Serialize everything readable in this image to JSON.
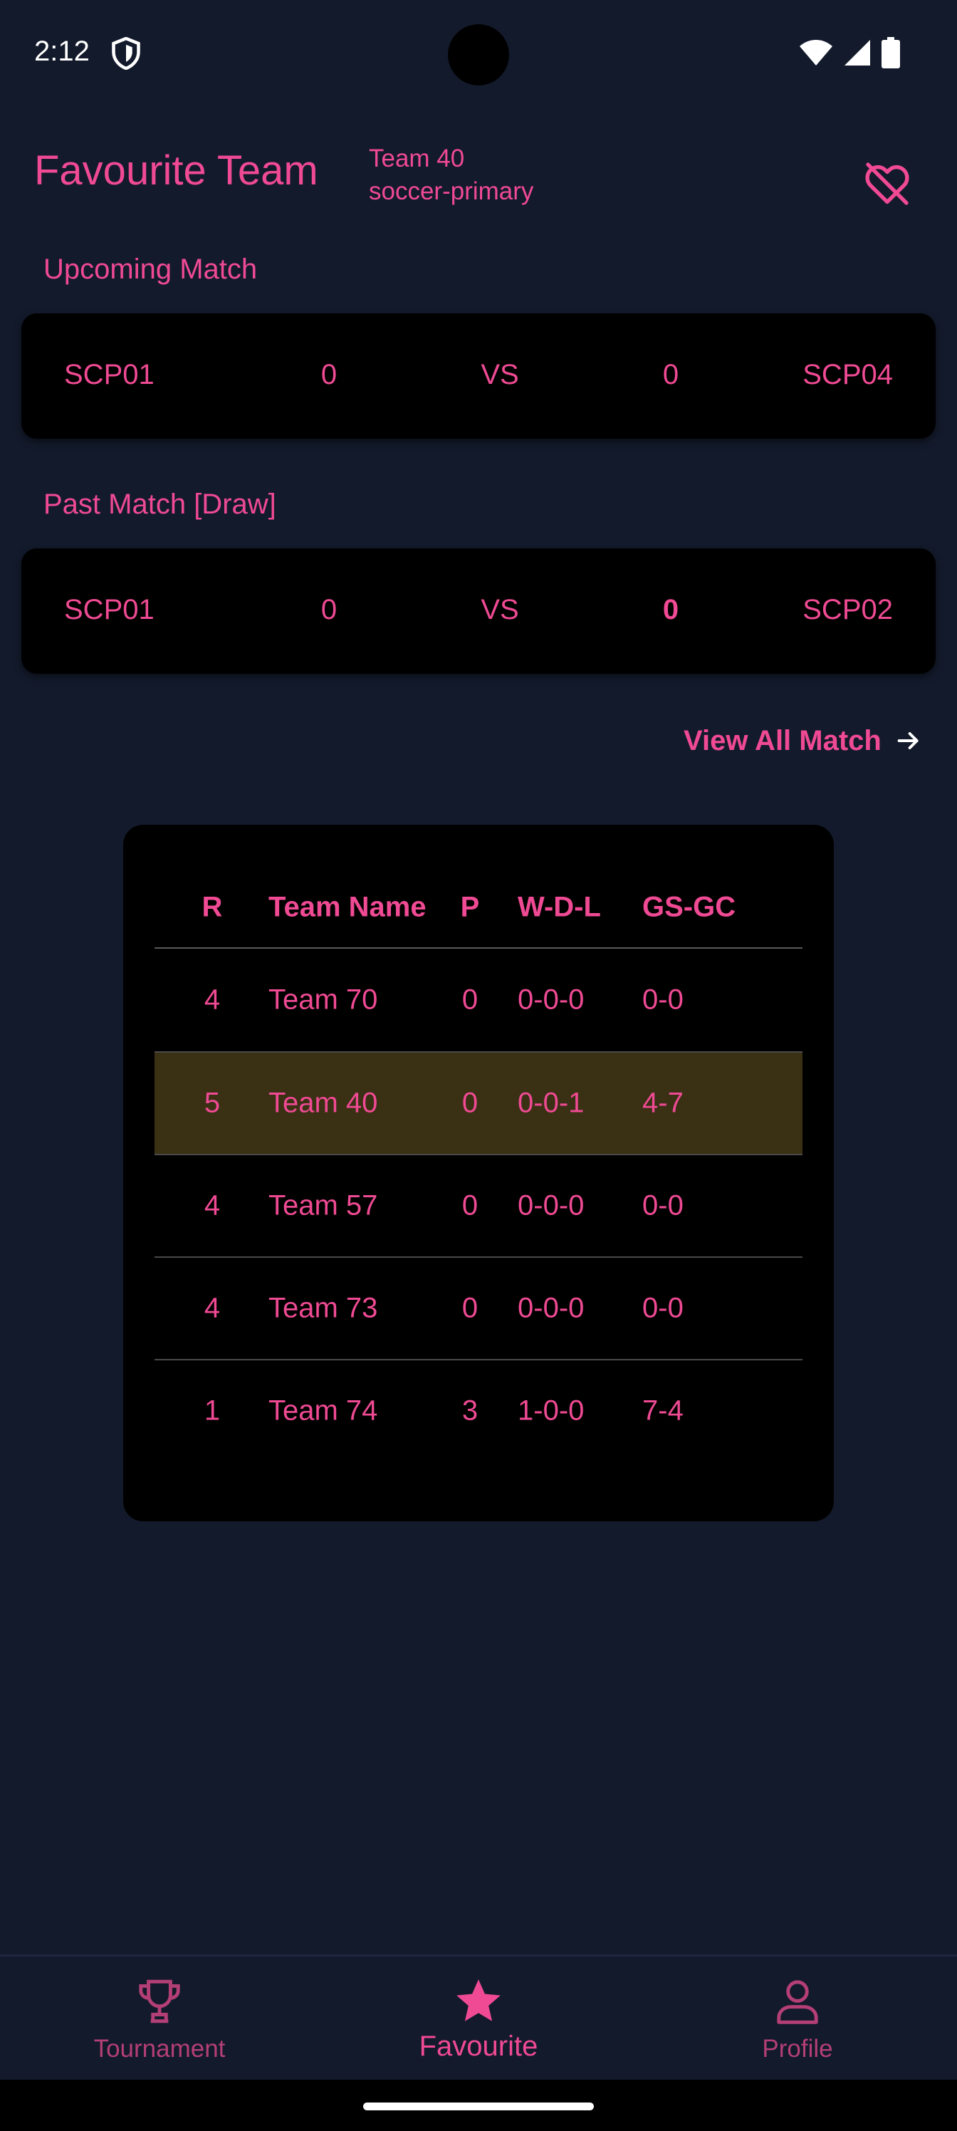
{
  "status_bar": {
    "time": "2:12"
  },
  "header": {
    "title": "Favourite Team",
    "team_name": "Team 40",
    "team_category": "soccer-primary"
  },
  "upcoming": {
    "label": "Upcoming Match",
    "home": "SCP01",
    "home_score": "0",
    "vs": "VS",
    "away_score": "0",
    "away": "SCP04"
  },
  "past": {
    "label": "Past Match [Draw]",
    "home": "SCP01",
    "home_score": "0",
    "vs": "VS",
    "away_score": "0",
    "away": "SCP02"
  },
  "view_all": {
    "label": "View All Match"
  },
  "standings": {
    "headers": {
      "r": "R",
      "name": "Team Name",
      "p": "P",
      "wdl": "W-D-L",
      "gsgc": "GS-GC"
    },
    "rows": [
      {
        "r": "4",
        "name": "Team 70",
        "p": "0",
        "wdl": "0-0-0",
        "gsgc": "0-0"
      },
      {
        "r": "5",
        "name": "Team 40",
        "p": "0",
        "wdl": "0-0-1",
        "gsgc": "4-7"
      },
      {
        "r": "4",
        "name": "Team 57",
        "p": "0",
        "wdl": "0-0-0",
        "gsgc": "0-0"
      },
      {
        "r": "4",
        "name": "Team 73",
        "p": "0",
        "wdl": "0-0-0",
        "gsgc": "0-0"
      },
      {
        "r": "1",
        "name": "Team 74",
        "p": "3",
        "wdl": "1-0-0",
        "gsgc": "7-4"
      }
    ]
  },
  "nav": {
    "tournament": "Tournament",
    "favourite": "Favourite",
    "profile": "Profile"
  },
  "colors": {
    "background": "#131a2b",
    "accent": "#ef4a93",
    "card": "#000000",
    "highlight_row": "#3a3014"
  },
  "icons": [
    "shield-icon",
    "wifi-icon",
    "signal-icon",
    "battery-icon",
    "heart-off-icon",
    "arrow-right-icon",
    "trophy-icon",
    "star-icon",
    "person-icon"
  ]
}
